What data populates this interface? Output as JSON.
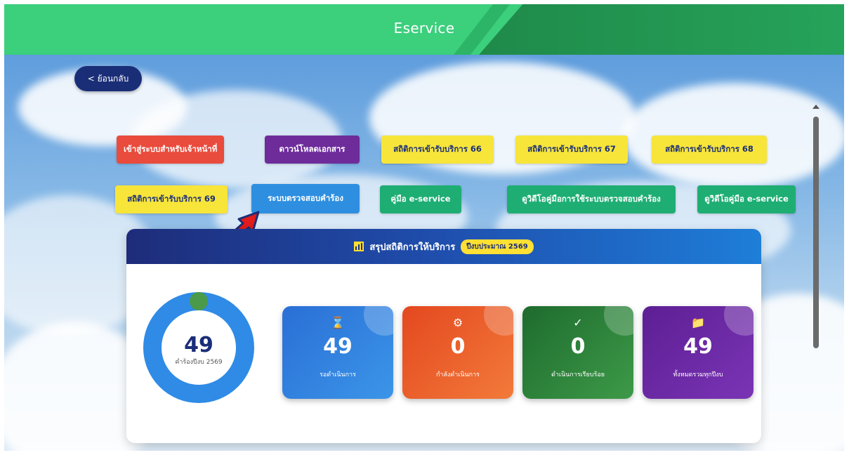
{
  "header": {
    "title": "Eservice"
  },
  "back_button": {
    "label": "< ย้อนกลับ"
  },
  "nav_buttons": {
    "staff_login": "เข้าสู่ระบบสำหรับเจ้าหน้าที่",
    "download_docs": "ดาวน์โหลดเอกสาร",
    "stats_66": "สถิติการเข้ารับบริการ 66",
    "stats_67": "สถิติการเข้ารับบริการ 67",
    "stats_68": "สถิติการเข้ารับบริการ 68",
    "stats_69": "สถิติการเข้ารับบริการ 69",
    "check_request": "ระบบตรวจสอบคำร้อง",
    "eservice_manual": "คู่มือ e-service",
    "video_check_manual": "ดูวิดีโอคู่มือการใช้ระบบตรวจสอบคำร้อง",
    "video_eservice_manual": "ดูวิดีโอคู่มือ e-service"
  },
  "summary": {
    "title": "สรุปสถิติการให้บริการ",
    "badge": "ปีงบประมาณ 2569",
    "donut": {
      "value": "49",
      "label": "คำร้องปีงบ 2569",
      "completed_fraction": 0.02
    },
    "stats": [
      {
        "icon": "hourglass-icon",
        "glyph": "⌛",
        "value": "49",
        "label": "รอดำเนินการ"
      },
      {
        "icon": "gear-icon",
        "glyph": "⚙",
        "value": "0",
        "label": "กำลังดำเนินการ"
      },
      {
        "icon": "check-icon",
        "glyph": "✓",
        "value": "0",
        "label": "ดำเนินการเรียบร้อย"
      },
      {
        "icon": "folder-icon",
        "glyph": "📁",
        "value": "49",
        "label": "ทั้งหมดรวมทุกปีงบ"
      }
    ]
  },
  "colors": {
    "header_green": "#3ccf7c",
    "header_dark_green": "#1f8a4a",
    "navy": "#1a2e78",
    "red": "#e94b3c",
    "purple": "#6d2c9a",
    "yellow": "#f7e53a",
    "blue": "#2e8fe0",
    "green": "#1eae73"
  }
}
